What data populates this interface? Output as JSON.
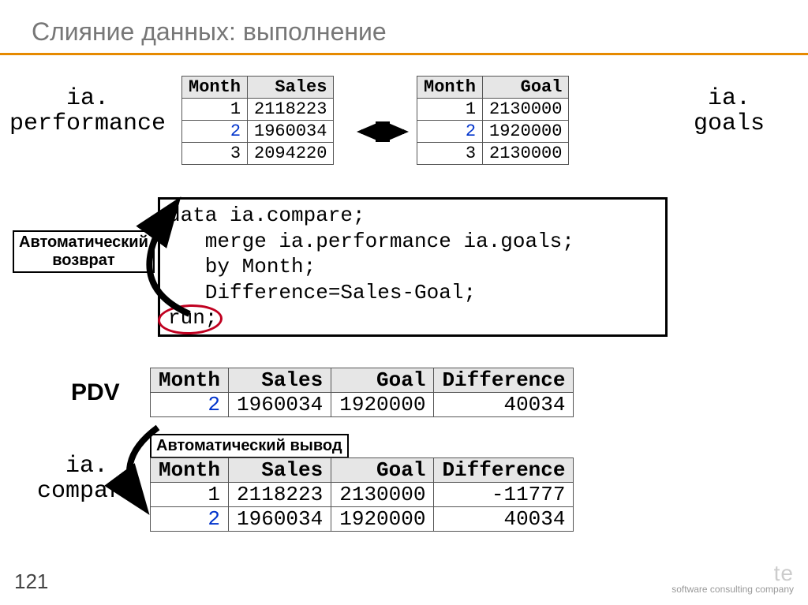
{
  "title": "Слияние данных: выполнение",
  "labels": {
    "performance": "ia.\nperformance",
    "goals": "ia.\ngoals",
    "pdv": "PDV",
    "compare": "ia.\ncompare",
    "auto_return": "Автоматический\nвозврат",
    "auto_output": "Автоматический вывод"
  },
  "code": "data ia.compare;\n   merge ia.performance ia.goals;\n   by Month;\n   Difference=Sales-Goal;\nrun;",
  "tables": {
    "performance": {
      "headers": [
        "Month",
        "Sales"
      ],
      "rows": [
        [
          "1",
          "2118223"
        ],
        [
          "2",
          "1960034"
        ],
        [
          "3",
          "2094220"
        ]
      ],
      "highlight_row": 1
    },
    "goals": {
      "headers": [
        "Month",
        "Goal"
      ],
      "rows": [
        [
          "1",
          "2130000"
        ],
        [
          "2",
          "1920000"
        ],
        [
          "3",
          "2130000"
        ]
      ],
      "highlight_row": 1
    },
    "pdv": {
      "headers": [
        "Month",
        "Sales",
        "Goal",
        "Difference"
      ],
      "rows": [
        [
          "2",
          "1960034",
          "1920000",
          "40034"
        ]
      ]
    },
    "compare": {
      "headers": [
        "Month",
        "Sales",
        "Goal",
        "Difference"
      ],
      "rows": [
        [
          "1",
          "2118223",
          "2130000",
          "-11777"
        ],
        [
          "2",
          "1960034",
          "1920000",
          "40034"
        ]
      ]
    }
  },
  "page_number": "121",
  "footer": {
    "brand": "te",
    "tagline": "software consulting company"
  }
}
